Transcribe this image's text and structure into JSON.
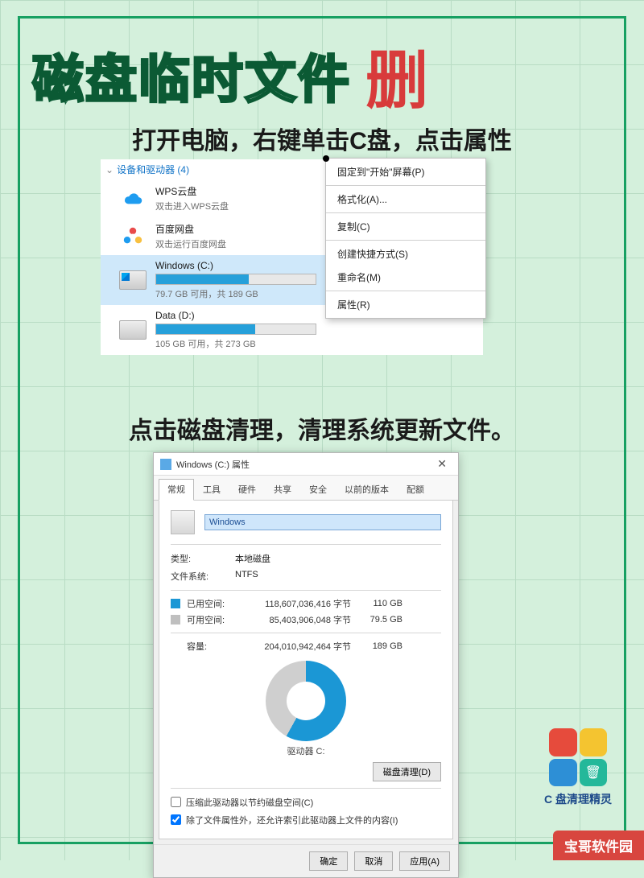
{
  "title_main": "磁盘临时文件",
  "title_accent": "删",
  "subtitle1": "打开电脑，右键单击C盘，点击属性",
  "subtitle2": "点击磁盘清理，清理系统更新文件。",
  "explorer": {
    "section_header": "设备和驱动器 (4)",
    "wps": {
      "name": "WPS云盘",
      "sub": "双击进入WPS云盘"
    },
    "baidu": {
      "name": "百度网盘",
      "sub": "双击运行百度网盘"
    },
    "c": {
      "name": "Windows (C:)",
      "sub": "79.7 GB 可用，共 189 GB"
    },
    "d": {
      "name": "Data (D:)",
      "sub": "105 GB 可用，共 273 GB"
    }
  },
  "context": {
    "pin": "固定到\"开始\"屏幕(P)",
    "format": "格式化(A)...",
    "copy": "复制(C)",
    "shortcut": "创建快捷方式(S)",
    "rename": "重命名(M)",
    "properties": "属性(R)"
  },
  "props": {
    "title": "Windows (C:) 属性",
    "tabs": {
      "t0": "常规",
      "t1": "工具",
      "t2": "硬件",
      "t3": "共享",
      "t4": "安全",
      "t5": "以前的版本",
      "t6": "配额"
    },
    "name_value": "Windows",
    "type_k": "类型:",
    "type_v": "本地磁盘",
    "fs_k": "文件系统:",
    "fs_v": "NTFS",
    "used_label": "已用空间:",
    "used_bytes": "118,607,036,416 字节",
    "used_gb": "110 GB",
    "free_label": "可用空间:",
    "free_bytes": "85,403,906,048 字节",
    "free_gb": "79.5 GB",
    "cap_label": "容量:",
    "cap_bytes": "204,010,942,464 字节",
    "cap_gb": "189 GB",
    "drive_label": "驱动器 C:",
    "cleanup_btn": "磁盘清理(D)",
    "compress": "压缩此驱动器以节约磁盘空间(C)",
    "index": "除了文件属性外，还允许索引此驱动器上文件的内容(I)",
    "ok": "确定",
    "cancel": "取消",
    "apply": "应用(A)"
  },
  "brand": "C 盘清理精灵",
  "watermark": "宝哥软件园"
}
